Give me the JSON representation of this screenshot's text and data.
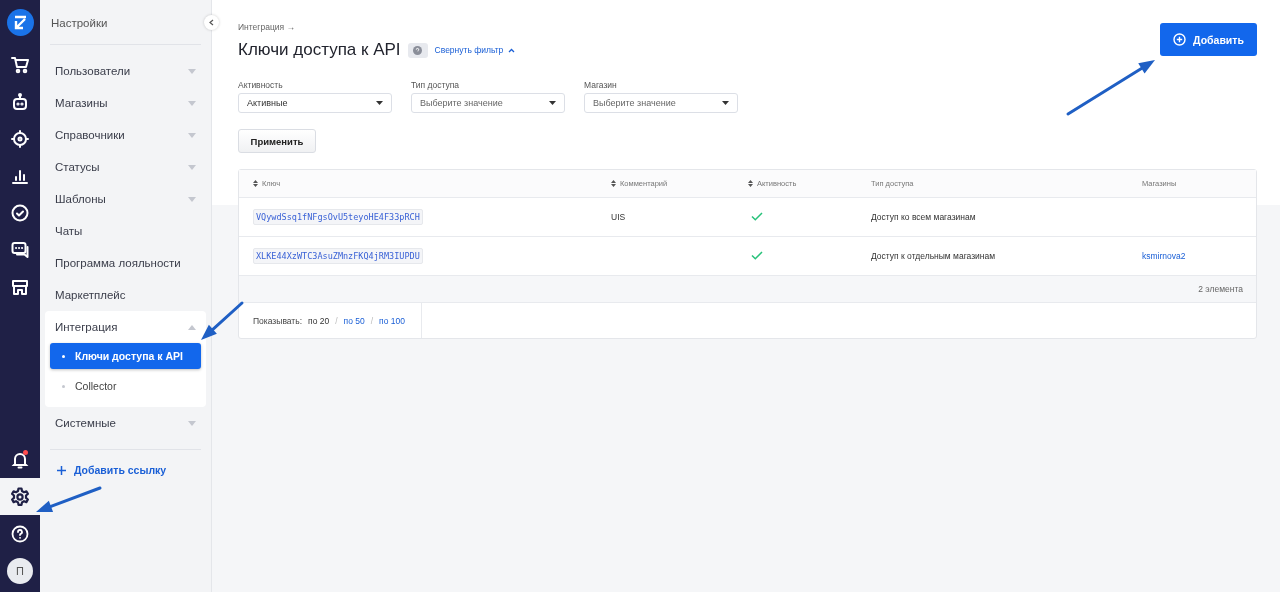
{
  "rail": {
    "top": [
      {
        "selected": false
      },
      {
        "selected": false
      },
      {
        "selected": false
      },
      {
        "selected": false
      },
      {
        "selected": false
      },
      {
        "selected": false
      },
      {
        "selected": false
      }
    ],
    "bottom": [
      {
        "selected": false,
        "badge": true
      },
      {
        "selected": true
      },
      {
        "selected": false
      }
    ],
    "avatar": "П"
  },
  "sidebar": {
    "title": "Настройки",
    "items": [
      {
        "label": "Пользователи",
        "expanded": false
      },
      {
        "label": "Магазины",
        "expanded": false
      },
      {
        "label": "Справочники",
        "expanded": false
      },
      {
        "label": "Статусы",
        "expanded": false
      },
      {
        "label": "Шаблоны",
        "expanded": false
      },
      {
        "label": "Чаты"
      },
      {
        "label": "Программа лояльности"
      },
      {
        "label": "Маркетплейс"
      },
      {
        "label": "Интеграция",
        "expanded": true,
        "children": [
          {
            "label": "Ключи доступа к API",
            "selected": true
          },
          {
            "label": "Collector",
            "selected": false
          }
        ]
      },
      {
        "label": "Системные",
        "expanded": false
      }
    ],
    "add_link": "Добавить ссылку"
  },
  "main": {
    "breadcrumb": "Интеграция →",
    "title": "Ключи доступа к API",
    "filter_toggle": "Свернуть фильтр",
    "add_button": "Добавить",
    "filters": [
      {
        "label": "Активность",
        "value": "Активные"
      },
      {
        "label": "Тип доступа",
        "placeholder": "Выберите значение"
      },
      {
        "label": "Магазин",
        "placeholder": "Выберите значение"
      }
    ],
    "apply_button": "Применить",
    "table": {
      "columns": [
        {
          "label": "Ключ",
          "sortable": true
        },
        {
          "label": "Комментарий",
          "sortable": true
        },
        {
          "label": "Активность",
          "sortable": true
        },
        {
          "label": "Тип доступа",
          "sortable": false
        },
        {
          "label": "Магазины",
          "sortable": false
        }
      ],
      "rows": [
        {
          "key": "VQywdSsq1fNFgsOvU5teyoHE4F33pRCH",
          "comment": "UIS",
          "active": true,
          "access_type": "Доступ ко всем магазинам"
        },
        {
          "key": "XLKE44XzWTC3AsuZMnzFKQ4jRM3IUPDU",
          "active": true,
          "access_type": "Доступ к отдельным магазинам",
          "store": "ksmirnova2"
        }
      ],
      "count": "2 элемента"
    },
    "page_size": {
      "label": "Показывать:",
      "separator": "/",
      "options": [
        {
          "label": "по 20",
          "selected": true
        },
        {
          "label": "по 50",
          "selected": false
        },
        {
          "label": "по 100",
          "selected": false
        }
      ]
    }
  },
  "annotations": [
    {
      "kind": "arrow"
    },
    {
      "kind": "arrow"
    },
    {
      "kind": "arrow"
    }
  ]
}
